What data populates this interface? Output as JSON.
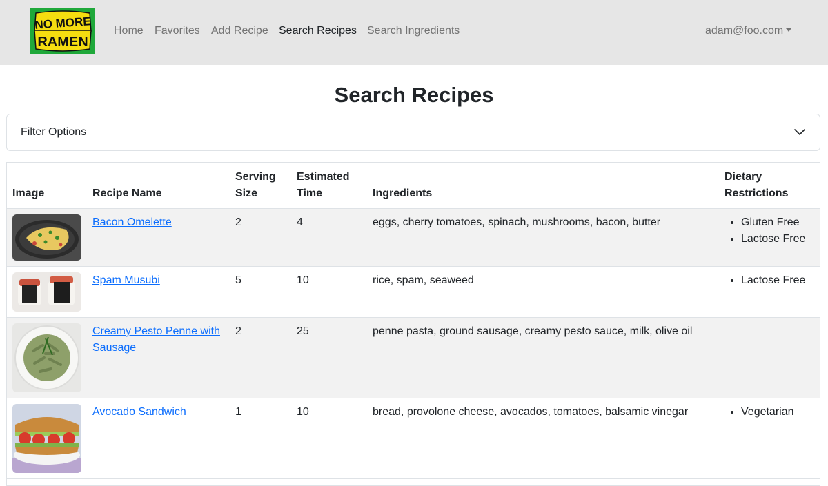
{
  "logo": {
    "line1": "NO MORE",
    "line2": "RAMEN",
    "colors": {
      "green": "#1fa83a",
      "yellow": "#f5dd10",
      "ink": "#111111"
    }
  },
  "nav": {
    "items": [
      {
        "label": "Home",
        "active": false
      },
      {
        "label": "Favorites",
        "active": false
      },
      {
        "label": "Add Recipe",
        "active": false
      },
      {
        "label": "Search Recipes",
        "active": true
      },
      {
        "label": "Search Ingredients",
        "active": false
      }
    ],
    "user": "adam@foo.com"
  },
  "page": {
    "title": "Search Recipes"
  },
  "filter": {
    "label": "Filter Options",
    "icon": "chevron-down-icon"
  },
  "table": {
    "headers": {
      "image": "Image",
      "name": "Recipe Name",
      "serving_1": "Serving",
      "serving_2": "Size",
      "time_1": "Estimated",
      "time_2": "Time",
      "ingredients": "Ingredients",
      "diet_1": "Dietary",
      "diet_2": "Restrictions"
    },
    "rows": [
      {
        "name": "Bacon Omelette",
        "serving": "2",
        "time": "4",
        "ingredients": "eggs, cherry tomatoes, spinach, mushrooms, bacon, butter",
        "diet": [
          "Gluten Free",
          "Lactose Free"
        ],
        "image": "omelette-photo"
      },
      {
        "name": "Spam Musubi",
        "serving": "5",
        "time": "10",
        "ingredients": "rice, spam, seaweed",
        "diet": [
          "Lactose Free"
        ],
        "image": "musubi-photo"
      },
      {
        "name": "Creamy Pesto Penne with Sausage",
        "serving": "2",
        "time": "25",
        "ingredients": "penne pasta, ground sausage, creamy pesto sauce, milk, olive oil",
        "diet": [],
        "image": "pesto-penne-photo"
      },
      {
        "name": "Avocado Sandwich",
        "serving": "1",
        "time": "10",
        "ingredients": "bread, provolone cheese, avocados, tomatoes, balsamic vinegar",
        "diet": [
          "Vegetarian"
        ],
        "image": "sandwich-photo"
      }
    ]
  },
  "colors": {
    "navbar": "#e6e6e6",
    "link": "#0d6efd",
    "stripe": "#f2f2f2",
    "border": "#dee2e6"
  }
}
